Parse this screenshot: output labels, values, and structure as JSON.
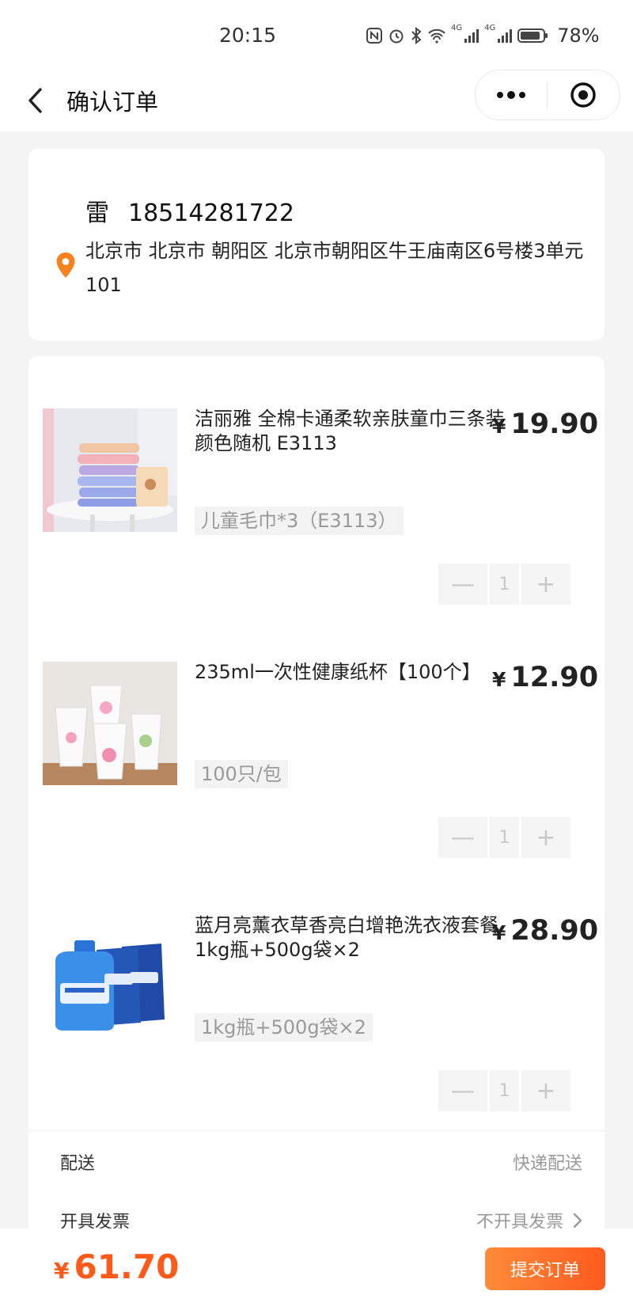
{
  "status_bar": {
    "time": "20:15",
    "network_1": "4G",
    "network_2": "4G",
    "battery": "78%"
  },
  "nav": {
    "title": "确认订单"
  },
  "address": {
    "name": "雷",
    "phone": "18514281722",
    "text": "北京市 北京市 朝阳区 北京市朝阳区牛王庙南区6号楼3单元101"
  },
  "items": [
    {
      "name": "洁丽雅 全棉卡通柔软亲肤童巾三条装 颜色随机 E3113",
      "currency": "¥",
      "price": "19.90",
      "spec": "儿童毛巾*3（E3113）",
      "qty": "1",
      "minus": "—",
      "plus": "+"
    },
    {
      "name": "235ml一次性健康纸杯【100个】",
      "currency": "¥",
      "price": "12.90",
      "spec": "100只/包",
      "qty": "1",
      "minus": "—",
      "plus": "+"
    },
    {
      "name": "蓝月亮薰衣草香亮白增艳洗衣液套餐1kg瓶+500g袋×2",
      "currency": "¥",
      "price": "28.90",
      "spec": "1kg瓶+500g袋×2",
      "qty": "1",
      "minus": "—",
      "plus": "+"
    }
  ],
  "delivery": {
    "label": "配送",
    "value": "快递配送"
  },
  "invoice": {
    "label": "开具发票",
    "value": "不开具发票"
  },
  "footer": {
    "currency": "¥",
    "total": "61.70",
    "submit_label": "提交订单"
  },
  "colors": {
    "accent": "#ff5a1a",
    "pin": "#f5821f",
    "background": "#f4f4f4"
  },
  "icons": [
    "back-icon",
    "more-icon",
    "close-target-icon",
    "location-pin-icon",
    "chevron-right-icon",
    "towel-image",
    "paper-cup-image",
    "detergent-image"
  ]
}
